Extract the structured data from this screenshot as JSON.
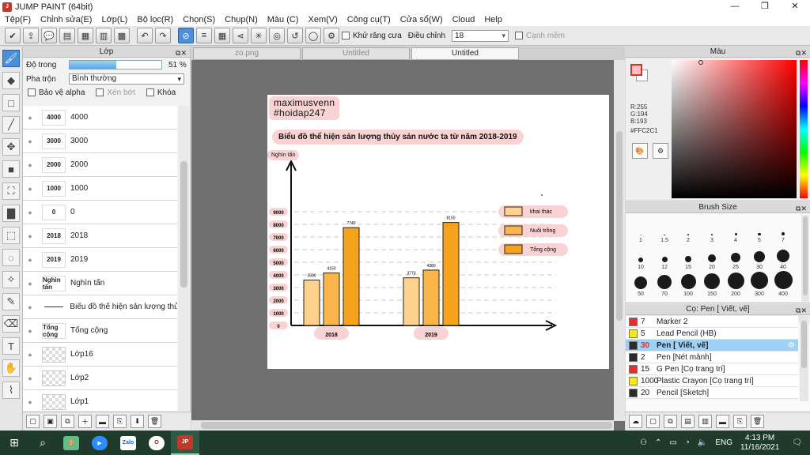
{
  "window": {
    "title": "JUMP PAINT (64bit)",
    "minimize": "—",
    "restore": "❐",
    "close": "✕"
  },
  "menu": [
    "Tệp(F)",
    "Chỉnh sửa(E)",
    "Lớp(L)",
    "Bộ lọc(R)",
    "Chọn(S)",
    "Chụp(N)",
    "Màu (C)",
    "Xem(V)",
    "Công cụ(T)",
    "Cửa sổ(W)",
    "Cloud",
    "Help"
  ],
  "command_bar": {
    "antialias_label": "Khử răng cưa",
    "adjust_label": "Điều chỉnh",
    "adjust_value": "18",
    "smooth_edge_label": "Cạnh mềm"
  },
  "layer_panel": {
    "title": "Lớp",
    "opacity_label": "Độ trong",
    "opacity_value": "51 %",
    "opacity_fraction": 0.51,
    "blend_label": "Pha trộn",
    "blend_value": "Bình thường",
    "protect_alpha": "Bảo vệ alpha",
    "clip": "Xén bớt",
    "lock": "Khóa",
    "layers": [
      {
        "thumb": "4000",
        "name": "4000",
        "kind": "text"
      },
      {
        "thumb": "3000",
        "name": "3000",
        "kind": "text"
      },
      {
        "thumb": "2000",
        "name": "2000",
        "kind": "text"
      },
      {
        "thumb": "1000",
        "name": "1000",
        "kind": "text"
      },
      {
        "thumb": "0",
        "name": "0",
        "kind": "text"
      },
      {
        "thumb": "2018",
        "name": "2018",
        "kind": "text"
      },
      {
        "thumb": "2019",
        "name": "2019",
        "kind": "text"
      },
      {
        "thumb": "Nghìn tấn",
        "name": "Nghìn tấn",
        "kind": "text"
      },
      {
        "thumb": "",
        "name": "Biểu đồ thể hiện sản lượng thủ",
        "kind": "line"
      },
      {
        "thumb": "Tổng cộng",
        "name": "Tổng cộng",
        "kind": "text"
      },
      {
        "thumb": "",
        "name": "Lớp16",
        "kind": "checker"
      },
      {
        "thumb": "",
        "name": "Lớp2",
        "kind": "checker"
      },
      {
        "thumb": "",
        "name": "Lớp1",
        "kind": "checker"
      }
    ]
  },
  "tabs": [
    "zo.png",
    "Untitled",
    "Untitled"
  ],
  "canvas": {
    "author_line1": "maximusvenn",
    "author_line2": "#hoidap247",
    "unit": "Nghìn tấn"
  },
  "chart_data": {
    "type": "bar",
    "title": "Biểu đồ thể hiện sản lượng thủy sản nước ta từ năm 2018-2019",
    "ylabel": "Nghìn tấn",
    "categories": [
      "2018",
      "2019"
    ],
    "series": [
      {
        "name": "khai thác",
        "values": [
          3590,
          3770
        ],
        "color": "#FFD18C"
      },
      {
        "name": "Nuôi trồng",
        "values": [
          4150,
          4380
        ],
        "color": "#FBB54B"
      },
      {
        "name": "Tổng cộng",
        "values": [
          7740,
          8150
        ],
        "color": "#F5A21C"
      }
    ],
    "yticks": [
      0,
      1000,
      2000,
      3000,
      4000,
      5000,
      6000,
      7000,
      8000,
      9000
    ],
    "ylim": [
      0,
      9000
    ],
    "legend": "right",
    "grid": true
  },
  "color_panel": {
    "title": "Màu",
    "r": "R:255",
    "g": "G:194",
    "b": "B:193",
    "hex": "#FFC2C1",
    "main_color": "#FFC2C1"
  },
  "brush_size": {
    "title": "Brush Size",
    "sizes": [
      "1",
      "1.5",
      "2",
      "3",
      "4",
      "5",
      "7",
      "10",
      "12",
      "15",
      "20",
      "25",
      "30",
      "40",
      "50",
      "70",
      "100",
      "150",
      "200",
      "300",
      "400"
    ]
  },
  "subtool": {
    "title": "Cọ: Pen [ Viết, vẽ]",
    "items": [
      {
        "size": "7",
        "name": "Marker 2",
        "color": "#e23030",
        "active": false
      },
      {
        "size": "5",
        "name": "Lead Pencil (HB)",
        "color": "#f5e62a",
        "active": false
      },
      {
        "size": "30",
        "name": "Pen [ Viết, vẽ]",
        "color": "#2a2a2a",
        "active": true
      },
      {
        "size": "2",
        "name": "Pen [Nét mảnh]",
        "color": "#2a2a2a",
        "active": false
      },
      {
        "size": "15",
        "name": "G Pen [Cọ trang trí]",
        "color": "#e23030",
        "active": false
      },
      {
        "size": "1000",
        "name": "Plastic Crayon [Cọ trang trí]",
        "color": "#f5e62a",
        "active": false
      },
      {
        "size": "20",
        "name": "Pencil [Sketch]",
        "color": "#2a2a2a",
        "active": false
      }
    ]
  },
  "taskbar": {
    "lang": "ENG",
    "time": "4:13 PM",
    "date": "11/16/2021"
  }
}
